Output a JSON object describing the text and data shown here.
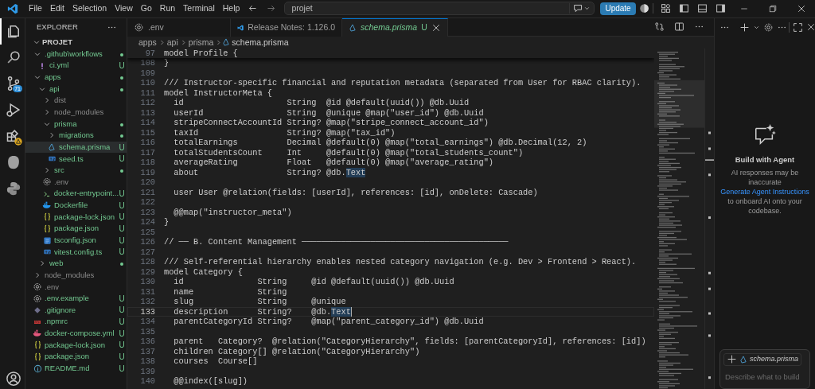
{
  "title_bar": {
    "menu": [
      "File",
      "Edit",
      "Selection",
      "View",
      "Go",
      "Run",
      "Terminal",
      "Help"
    ],
    "search": {
      "value": "projet"
    },
    "update_button": "Update"
  },
  "activity_bar": [
    {
      "kind": "files",
      "selected": true
    },
    {
      "kind": "search",
      "selected": false
    },
    {
      "kind": "source-control",
      "selected": false,
      "badge": "71"
    },
    {
      "kind": "debug",
      "selected": false
    },
    {
      "kind": "extensions",
      "selected": false,
      "warning": true
    },
    {
      "kind": "blob",
      "selected": false
    },
    {
      "kind": "python",
      "selected": false
    }
  ],
  "sidebar": {
    "title": "EXPLORER",
    "root": {
      "label": "PROJET",
      "expanded": true
    },
    "tree": [
      {
        "kind": "folder",
        "label": ".github\\workflows",
        "expanded": true,
        "ignored": false,
        "status_dot": true,
        "selected": false,
        "children": [
          {
            "kind": "yaml",
            "label": "ci.yml",
            "status": "U",
            "ignored": false,
            "selected": false
          }
        ]
      },
      {
        "kind": "folder",
        "label": "apps",
        "expanded": true,
        "ignored": false,
        "status_dot": true,
        "selected": false,
        "children": [
          {
            "kind": "folder",
            "label": "api",
            "expanded": true,
            "ignored": false,
            "status_dot": true,
            "selected": false,
            "children": [
              {
                "kind": "folder",
                "label": "dist",
                "expanded": false,
                "ignored": true,
                "status_dot": false,
                "selected": false
              },
              {
                "kind": "folder",
                "label": "node_modules",
                "expanded": false,
                "ignored": true,
                "status_dot": false,
                "selected": false
              },
              {
                "kind": "folder",
                "label": "prisma",
                "expanded": true,
                "ignored": false,
                "status_dot": true,
                "selected": false,
                "children": [
                  {
                    "kind": "folder",
                    "label": "migrations",
                    "expanded": false,
                    "ignored": false,
                    "status_dot": true,
                    "selected": false
                  },
                  {
                    "kind": "prisma",
                    "label": "schema.prisma",
                    "status": "U",
                    "ignored": false,
                    "selected": true
                  },
                  {
                    "kind": "ts",
                    "label": "seed.ts",
                    "status": "U",
                    "ignored": false,
                    "selected": false
                  }
                ]
              },
              {
                "kind": "folder",
                "label": "src",
                "expanded": false,
                "ignored": false,
                "status_dot": true,
                "selected": false
              },
              {
                "kind": "settings",
                "label": ".env",
                "ignored": true,
                "selected": false
              },
              {
                "kind": "shell",
                "label": "docker-entrypoint...",
                "status": "U",
                "ignored": false,
                "selected": false
              },
              {
                "kind": "docker",
                "label": "Dockerfile",
                "status": "U",
                "ignored": false,
                "selected": false
              },
              {
                "kind": "json",
                "label": "package-lock.json",
                "status": "U",
                "ignored": false,
                "selected": false
              },
              {
                "kind": "json",
                "label": "package.json",
                "status": "U",
                "ignored": false,
                "selected": false
              },
              {
                "kind": "tsconfig",
                "label": "tsconfig.json",
                "status": "U",
                "ignored": false,
                "selected": false
              },
              {
                "kind": "ts",
                "label": "vitest.config.ts",
                "status": "U",
                "ignored": false,
                "selected": false
              }
            ]
          },
          {
            "kind": "folder",
            "label": "web",
            "expanded": false,
            "ignored": false,
            "status_dot": true,
            "selected": false
          }
        ]
      },
      {
        "kind": "folder",
        "label": "node_modules",
        "expanded": false,
        "ignored": true,
        "status_dot": false,
        "selected": false
      },
      {
        "kind": "settings",
        "label": ".env",
        "ignored": true,
        "selected": false
      },
      {
        "kind": "settings",
        "label": ".env.example",
        "status": "U",
        "ignored": false,
        "selected": false
      },
      {
        "kind": "git",
        "label": ".gitignore",
        "status": "U",
        "ignored": false,
        "selected": false
      },
      {
        "kind": "npm",
        "label": ".npmrc",
        "status": "U",
        "ignored": false,
        "selected": false
      },
      {
        "kind": "compose",
        "label": "docker-compose.yml",
        "status": "U",
        "ignored": false,
        "selected": false
      },
      {
        "kind": "json",
        "label": "package-lock.json",
        "status": "U",
        "ignored": false,
        "selected": false
      },
      {
        "kind": "json",
        "label": "package.json",
        "status": "U",
        "ignored": false,
        "selected": false
      },
      {
        "kind": "info",
        "label": "README.md",
        "status": "U",
        "ignored": false,
        "selected": false
      }
    ]
  },
  "tabs": [
    {
      "kind": "settings",
      "label": ".env",
      "selected": false,
      "preview": false
    },
    {
      "kind": "vscode",
      "label": "Release Notes: 1.126.0",
      "selected": false,
      "preview": false
    },
    {
      "kind": "prisma",
      "label": "schema.prisma",
      "selected": true,
      "preview": true,
      "status": "U"
    }
  ],
  "breadcrumb": [
    "apps",
    "api",
    "prisma",
    "schema.prisma"
  ],
  "editor": {
    "sticky_line": {
      "number": "97",
      "text": "model Profile {"
    },
    "lines": [
      {
        "number": "108",
        "text": "}",
        "current": false
      },
      {
        "number": "109",
        "current": false
      },
      {
        "number": "110",
        "text": "/// Instructor-specific financial and reputation metadata (separated from User for RBAC clarity).",
        "current": false
      },
      {
        "number": "111",
        "text": "model InstructorMeta {",
        "current": false
      },
      {
        "number": "112",
        "text": "  id                     String  @id @default(uuid()) @db.Uuid",
        "current": false
      },
      {
        "number": "113",
        "text": "  userId                 String  @unique @map(\"user_id\") @db.Uuid",
        "current": false
      },
      {
        "number": "114",
        "text": "  stripeConnectAccountId String? @map(\"stripe_connect_account_id\")",
        "current": false
      },
      {
        "number": "115",
        "text": "  taxId                  String? @map(\"tax_id\")",
        "current": false
      },
      {
        "number": "116",
        "text": "  totalEarnings          Decimal @default(0) @map(\"total_earnings\") @db.Decimal(12, 2)",
        "current": false
      },
      {
        "number": "117",
        "text": "  totalStudentsCount     Int     @default(0) @map(\"total_students_count\")",
        "current": false
      },
      {
        "number": "118",
        "text": "  averageRating          Float   @default(0) @map(\"average_rating\")",
        "current": false
      },
      {
        "number": "119",
        "parts": [
          {
            "text": "  about                  String? @db.",
            "highlighted": false
          },
          {
            "text": "Text",
            "highlighted": true
          }
        ],
        "current": false
      },
      {
        "number": "120",
        "current": false
      },
      {
        "number": "121",
        "text": "  user User @relation(fields: [userId], references: [id], onDelete: Cascade)",
        "current": false
      },
      {
        "number": "122",
        "current": false
      },
      {
        "number": "123",
        "text": "  @@map(\"instructor_meta\")",
        "current": false
      },
      {
        "number": "124",
        "text": "}",
        "current": false
      },
      {
        "number": "125",
        "current": false
      },
      {
        "number": "126",
        "text": "// ── B. Content Management ──────────────────────────────────────────",
        "current": false
      },
      {
        "number": "127",
        "current": false
      },
      {
        "number": "128",
        "text": "/// Self-referential hierarchy enables nested category navigation (e.g. Dev > Frontend > React).",
        "current": false
      },
      {
        "number": "129",
        "text": "model Category {",
        "current": false
      },
      {
        "number": "130",
        "text": "  id               String     @id @default(uuid()) @db.Uuid",
        "current": false
      },
      {
        "number": "131",
        "text": "  name             String",
        "current": false
      },
      {
        "number": "132",
        "text": "  slug             String     @unique",
        "current": false
      },
      {
        "number": "133",
        "parts": [
          {
            "text": "  description      String?    @db.",
            "highlighted": false
          },
          {
            "text": "Text",
            "highlighted": true
          }
        ],
        "current": true
      },
      {
        "number": "134",
        "text": "  parentCategoryId String?    @map(\"parent_category_id\") @db.Uuid",
        "current": false
      },
      {
        "number": "135",
        "current": false
      },
      {
        "number": "136",
        "text": "  parent   Category?  @relation(\"CategoryHierarchy\", fields: [parentCategoryId], references: [id])",
        "current": false
      },
      {
        "number": "137",
        "text": "  children Category[] @relation(\"CategoryHierarchy\")",
        "current": false
      },
      {
        "number": "138",
        "text": "  courses  Course[]",
        "current": false
      },
      {
        "number": "139",
        "current": false
      },
      {
        "number": "140",
        "text": "  @@index([slug])",
        "current": false
      }
    ]
  },
  "chat": {
    "title": "Build with Agent",
    "note": "AI responses may be inaccurate",
    "link": "Generate Agent Instructions",
    "after_link": "to onboard AI onto your codebase.",
    "context_file": "schema.prisma",
    "placeholder": "Describe what to build"
  }
}
